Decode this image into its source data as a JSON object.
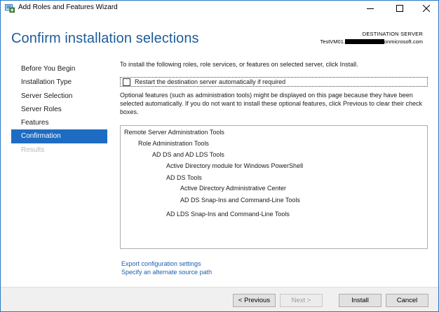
{
  "window": {
    "title": "Add Roles and Features Wizard",
    "controls": {
      "minimize": "—",
      "maximize": "☐",
      "close": "✕"
    }
  },
  "header": {
    "page_title": "Confirm installation selections",
    "destination_label": "DESTINATION SERVER",
    "destination_server_prefix": "TestVM01.",
    "destination_server_suffix": "onmicrosoft.com"
  },
  "sidebar": {
    "items": [
      {
        "label": "Before You Begin",
        "state": "normal"
      },
      {
        "label": "Installation Type",
        "state": "normal"
      },
      {
        "label": "Server Selection",
        "state": "normal"
      },
      {
        "label": "Server Roles",
        "state": "normal"
      },
      {
        "label": "Features",
        "state": "normal"
      },
      {
        "label": "Confirmation",
        "state": "active"
      },
      {
        "label": "Results",
        "state": "disabled"
      }
    ]
  },
  "content": {
    "intro": "To install the following roles, role services, or features on selected server, click Install.",
    "restart_checkbox": {
      "label": "Restart the destination server automatically if required",
      "checked": false
    },
    "optional_text": "Optional features (such as administration tools) might be displayed on this page because they have been selected automatically. If you do not want to install these optional features, click Previous to clear their check boxes.",
    "features": [
      {
        "label": "Remote Server Administration Tools",
        "level": 0
      },
      {
        "label": "Role Administration Tools",
        "level": 1
      },
      {
        "label": "AD DS and AD LDS Tools",
        "level": 2
      },
      {
        "label": "Active Directory module for Windows PowerShell",
        "level": 3
      },
      {
        "label": "AD DS Tools",
        "level": 3
      },
      {
        "label": "Active Directory Administrative Center",
        "level": 4
      },
      {
        "label": "AD DS Snap-Ins and Command-Line Tools",
        "level": 4
      },
      {
        "label": "AD LDS Snap-Ins and Command-Line Tools",
        "level": 3
      }
    ],
    "links": {
      "export": "Export configuration settings",
      "alternate_source": "Specify an alternate source path"
    }
  },
  "footer": {
    "previous": "< Previous",
    "next": "Next >",
    "install": "Install",
    "cancel": "Cancel"
  },
  "colors": {
    "accent": "#1e6cc2",
    "title_blue": "#1e5c9b",
    "link_blue": "#1b5fad"
  }
}
